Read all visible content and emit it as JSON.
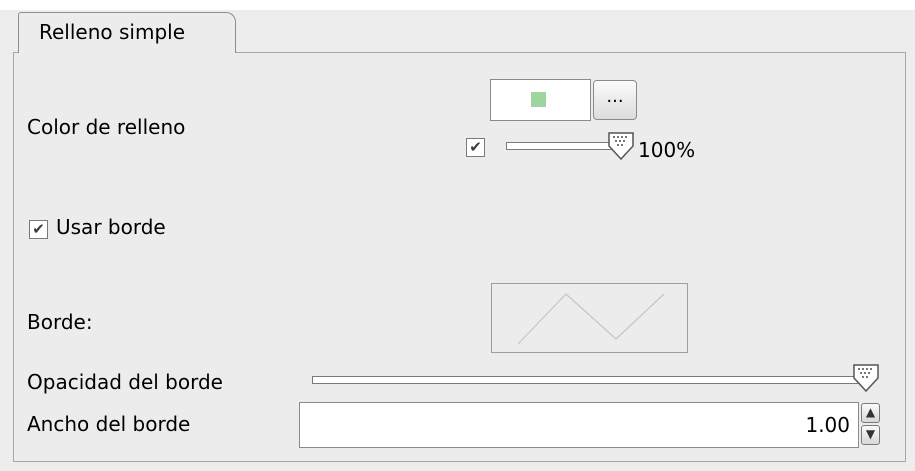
{
  "tab": {
    "label": "Relleno simple"
  },
  "fill": {
    "label": "Color de relleno",
    "color": "#9ed49e",
    "picker_button_label": "...",
    "opacity_enabled": true,
    "opacity_percent": 1.0,
    "opacity_label": "100%"
  },
  "border": {
    "use_border_label": "Usar borde",
    "use_border_checked": true,
    "border_label": "Borde:",
    "opacity_label": "Opacidad del borde",
    "opacity_fraction": 1.0,
    "width_label": "Ancho del borde",
    "width_value": "1.00"
  },
  "icons": {
    "checkbox": "check-icon",
    "spin_up": "arrow-up-icon",
    "spin_down": "arrow-down-icon"
  }
}
